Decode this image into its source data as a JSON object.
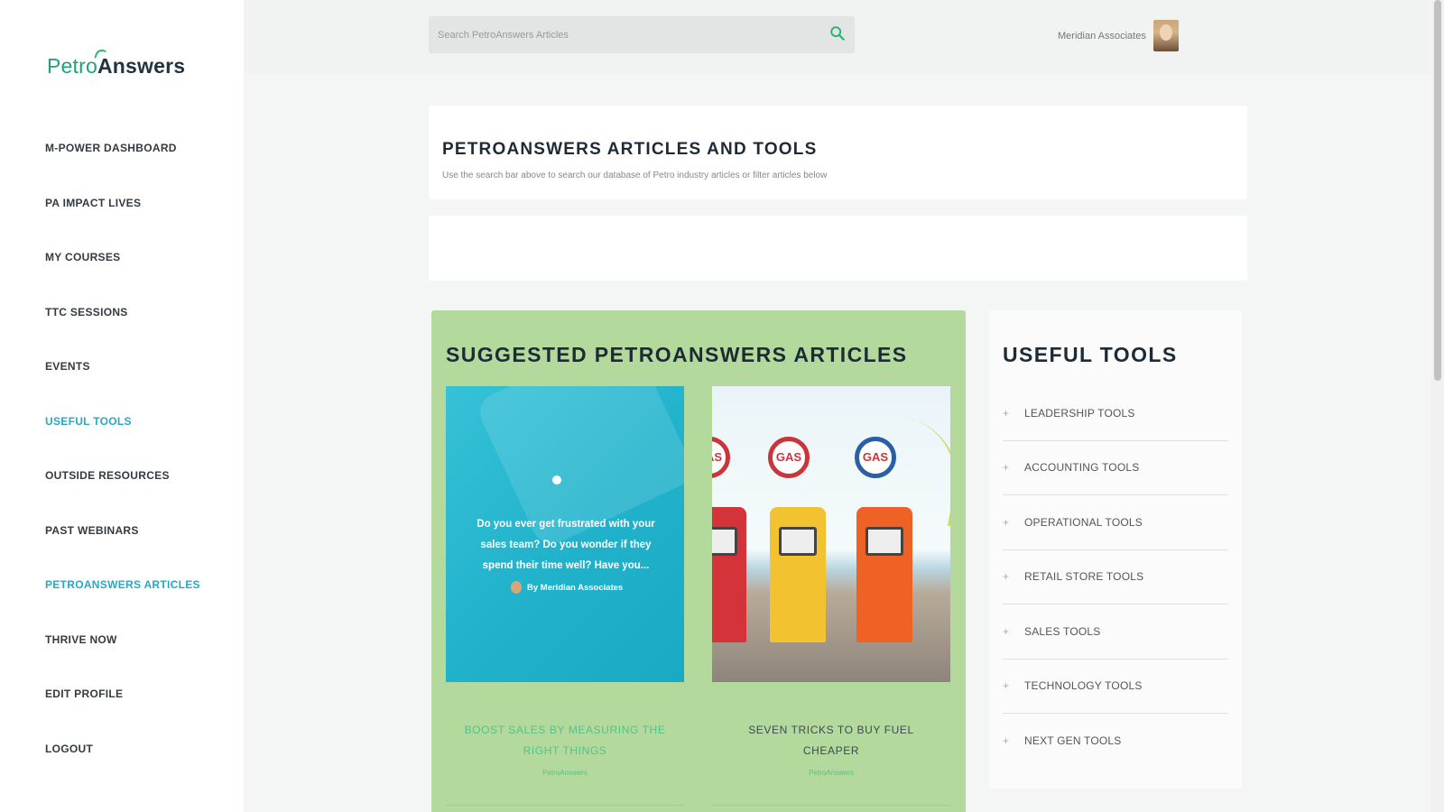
{
  "brand": {
    "part1": "Petro",
    "part2": "Answers"
  },
  "sidebar": {
    "items": [
      {
        "label": "M-Power Dashboard",
        "active": false
      },
      {
        "label": "PA Impact Lives",
        "active": false
      },
      {
        "label": "My Courses",
        "active": false
      },
      {
        "label": "TTC Sessions",
        "active": false
      },
      {
        "label": "Events",
        "active": false
      },
      {
        "label": "Useful Tools",
        "active": true
      },
      {
        "label": "Outside Resources",
        "active": false
      },
      {
        "label": "Past Webinars",
        "active": false
      },
      {
        "label": "PetroAnswers Articles",
        "active": true
      },
      {
        "label": "Thrive Now",
        "active": false
      },
      {
        "label": "Edit Profile",
        "active": false
      },
      {
        "label": "Logout",
        "active": false
      }
    ]
  },
  "topbar": {
    "search_placeholder": "Search PetroAnswers Articles",
    "search_icon": "search-icon",
    "user_name": "Meridian Associates"
  },
  "header": {
    "title": "PETROANSWERS ARTICLES AND TOOLS",
    "subtitle": "Use the search bar above to search our database of Petro industry articles or filter articles below"
  },
  "suggested": {
    "title": "SUGGESTED PETROANSWERS ARTICLES",
    "articles": [
      {
        "image_quote": "Do you ever get frustrated with your sales team? Do you wonder if they spend their time well? Have you...",
        "image_byline": "By Meridian Associates",
        "title": "Boost Sales by Measuring the Right Things",
        "meta": "PetroAnswers"
      },
      {
        "image_labels": [
          "GAS",
          "GAS",
          "GAS"
        ],
        "title": "Seven Tricks to Buy Fuel Cheaper",
        "meta": "PetroAnswers"
      }
    ]
  },
  "tools": {
    "title": "USEFUL TOOLS",
    "items": [
      {
        "label": "Leadership Tools"
      },
      {
        "label": "Accounting Tools"
      },
      {
        "label": "Operational Tools"
      },
      {
        "label": "Retail Store Tools"
      },
      {
        "label": "Sales Tools"
      },
      {
        "label": "Technology Tools"
      },
      {
        "label": "Next Gen Tools"
      }
    ],
    "expand_symbol": "+"
  },
  "colors": {
    "accent": "#28a8c4",
    "brand_green": "#1aa37a",
    "panel_green": "#b3d99d",
    "article_link_green": "#55c28a"
  }
}
